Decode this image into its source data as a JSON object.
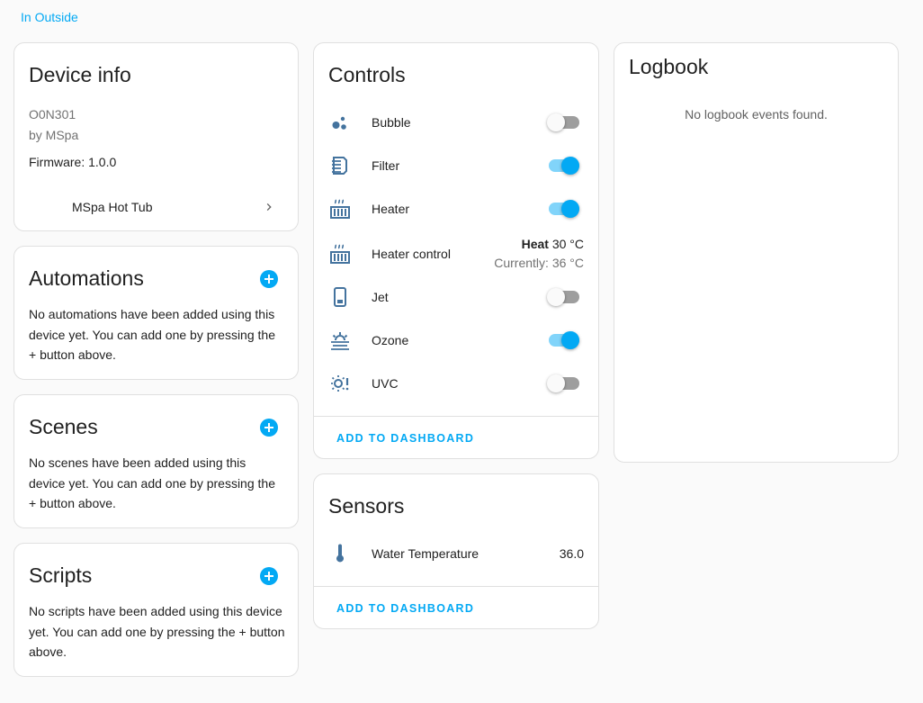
{
  "area_link": "In Outside",
  "device_info": {
    "title": "Device info",
    "model": "O0N301",
    "manufacturer": "by MSpa",
    "firmware": "Firmware: 1.0.0",
    "via": "MSpa Hot Tub"
  },
  "automations": {
    "title": "Automations",
    "text": "No automations have been added using this device yet. You can add one by pressing the + button above."
  },
  "scenes": {
    "title": "Scenes",
    "text": "No scenes have been added using this device yet. You can add one by pressing the + button above."
  },
  "scripts": {
    "title": "Scripts",
    "text": "No scripts have been added using this device yet. You can add one by pressing the + button above."
  },
  "controls": {
    "title": "Controls",
    "entities": [
      {
        "name": "Bubble",
        "icon": "bubble-icon",
        "state": "off"
      },
      {
        "name": "Filter",
        "icon": "filter-icon",
        "state": "on"
      },
      {
        "name": "Heater",
        "icon": "heater-icon",
        "state": "on"
      },
      {
        "name": "Heater control",
        "icon": "heater-icon",
        "mode": "Heat",
        "target": "30 °C",
        "current": "Currently: 36 °C"
      },
      {
        "name": "Jet",
        "icon": "jet-icon",
        "state": "off"
      },
      {
        "name": "Ozone",
        "icon": "ozone-icon",
        "state": "on"
      },
      {
        "name": "UVC",
        "icon": "uvc-icon",
        "state": "off"
      }
    ],
    "add_to_dashboard": "ADD TO DASHBOARD"
  },
  "sensors": {
    "title": "Sensors",
    "entities": [
      {
        "name": "Water Temperature",
        "icon": "thermometer-icon",
        "value": "36.0"
      }
    ],
    "add_to_dashboard": "ADD TO DASHBOARD"
  },
  "logbook": {
    "title": "Logbook",
    "empty": "No logbook events found."
  },
  "colors": {
    "accent": "#03a9f4",
    "icon": "#44739e",
    "background": "#fafafa"
  }
}
